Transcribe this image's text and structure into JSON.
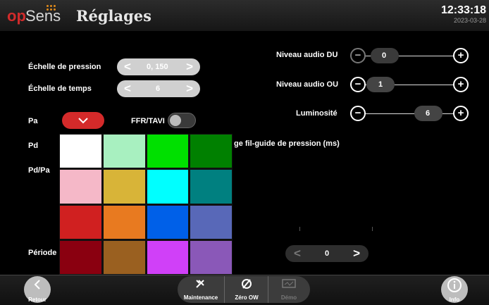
{
  "header": {
    "logo_op": "op",
    "logo_sens": "Sens",
    "title": "Réglages",
    "time": "12:33:18",
    "date": "2023-03-28"
  },
  "left": {
    "pressure_scale_label": "Échelle de pression",
    "pressure_scale_value": "0, 150",
    "time_scale_label": "Échelle de temps",
    "time_scale_value": "6",
    "pa_label": "Pa",
    "pd_label": "Pd",
    "pdpa_label": "Pd/Pa",
    "period_label": "Période",
    "ffr_tavi_label": "FFR/TAVI"
  },
  "right": {
    "audio_du_label": "Niveau audio DU",
    "audio_du_value": "0",
    "audio_ou_label": "Niveau audio OU",
    "audio_ou_value": "1",
    "brightness_label": "Luminosité",
    "brightness_value": "6",
    "guidewire_label": "ge fil-guide de pression (ms)",
    "delay_value": "0"
  },
  "color_palette": {
    "colors": [
      "#ffffff",
      "#a8f0c0",
      "#00e000",
      "#008000",
      "#f5b8c8",
      "#d8b438",
      "#00ffff",
      "#008080",
      "#d02020",
      "#e87a20",
      "#0060e8",
      "#5868b8",
      "#8a0010",
      "#9a6020",
      "#d040f8",
      "#8a58b8"
    ]
  },
  "colors": {
    "accent_red": "#d12b2b",
    "pill_gray": "#d0d0d0"
  },
  "footer": {
    "back_label": "Retour",
    "maintenance_label": "Maintenance",
    "zero_ow_label": "Zéro OW",
    "demo_label": "Démo",
    "info_label": "Info"
  }
}
